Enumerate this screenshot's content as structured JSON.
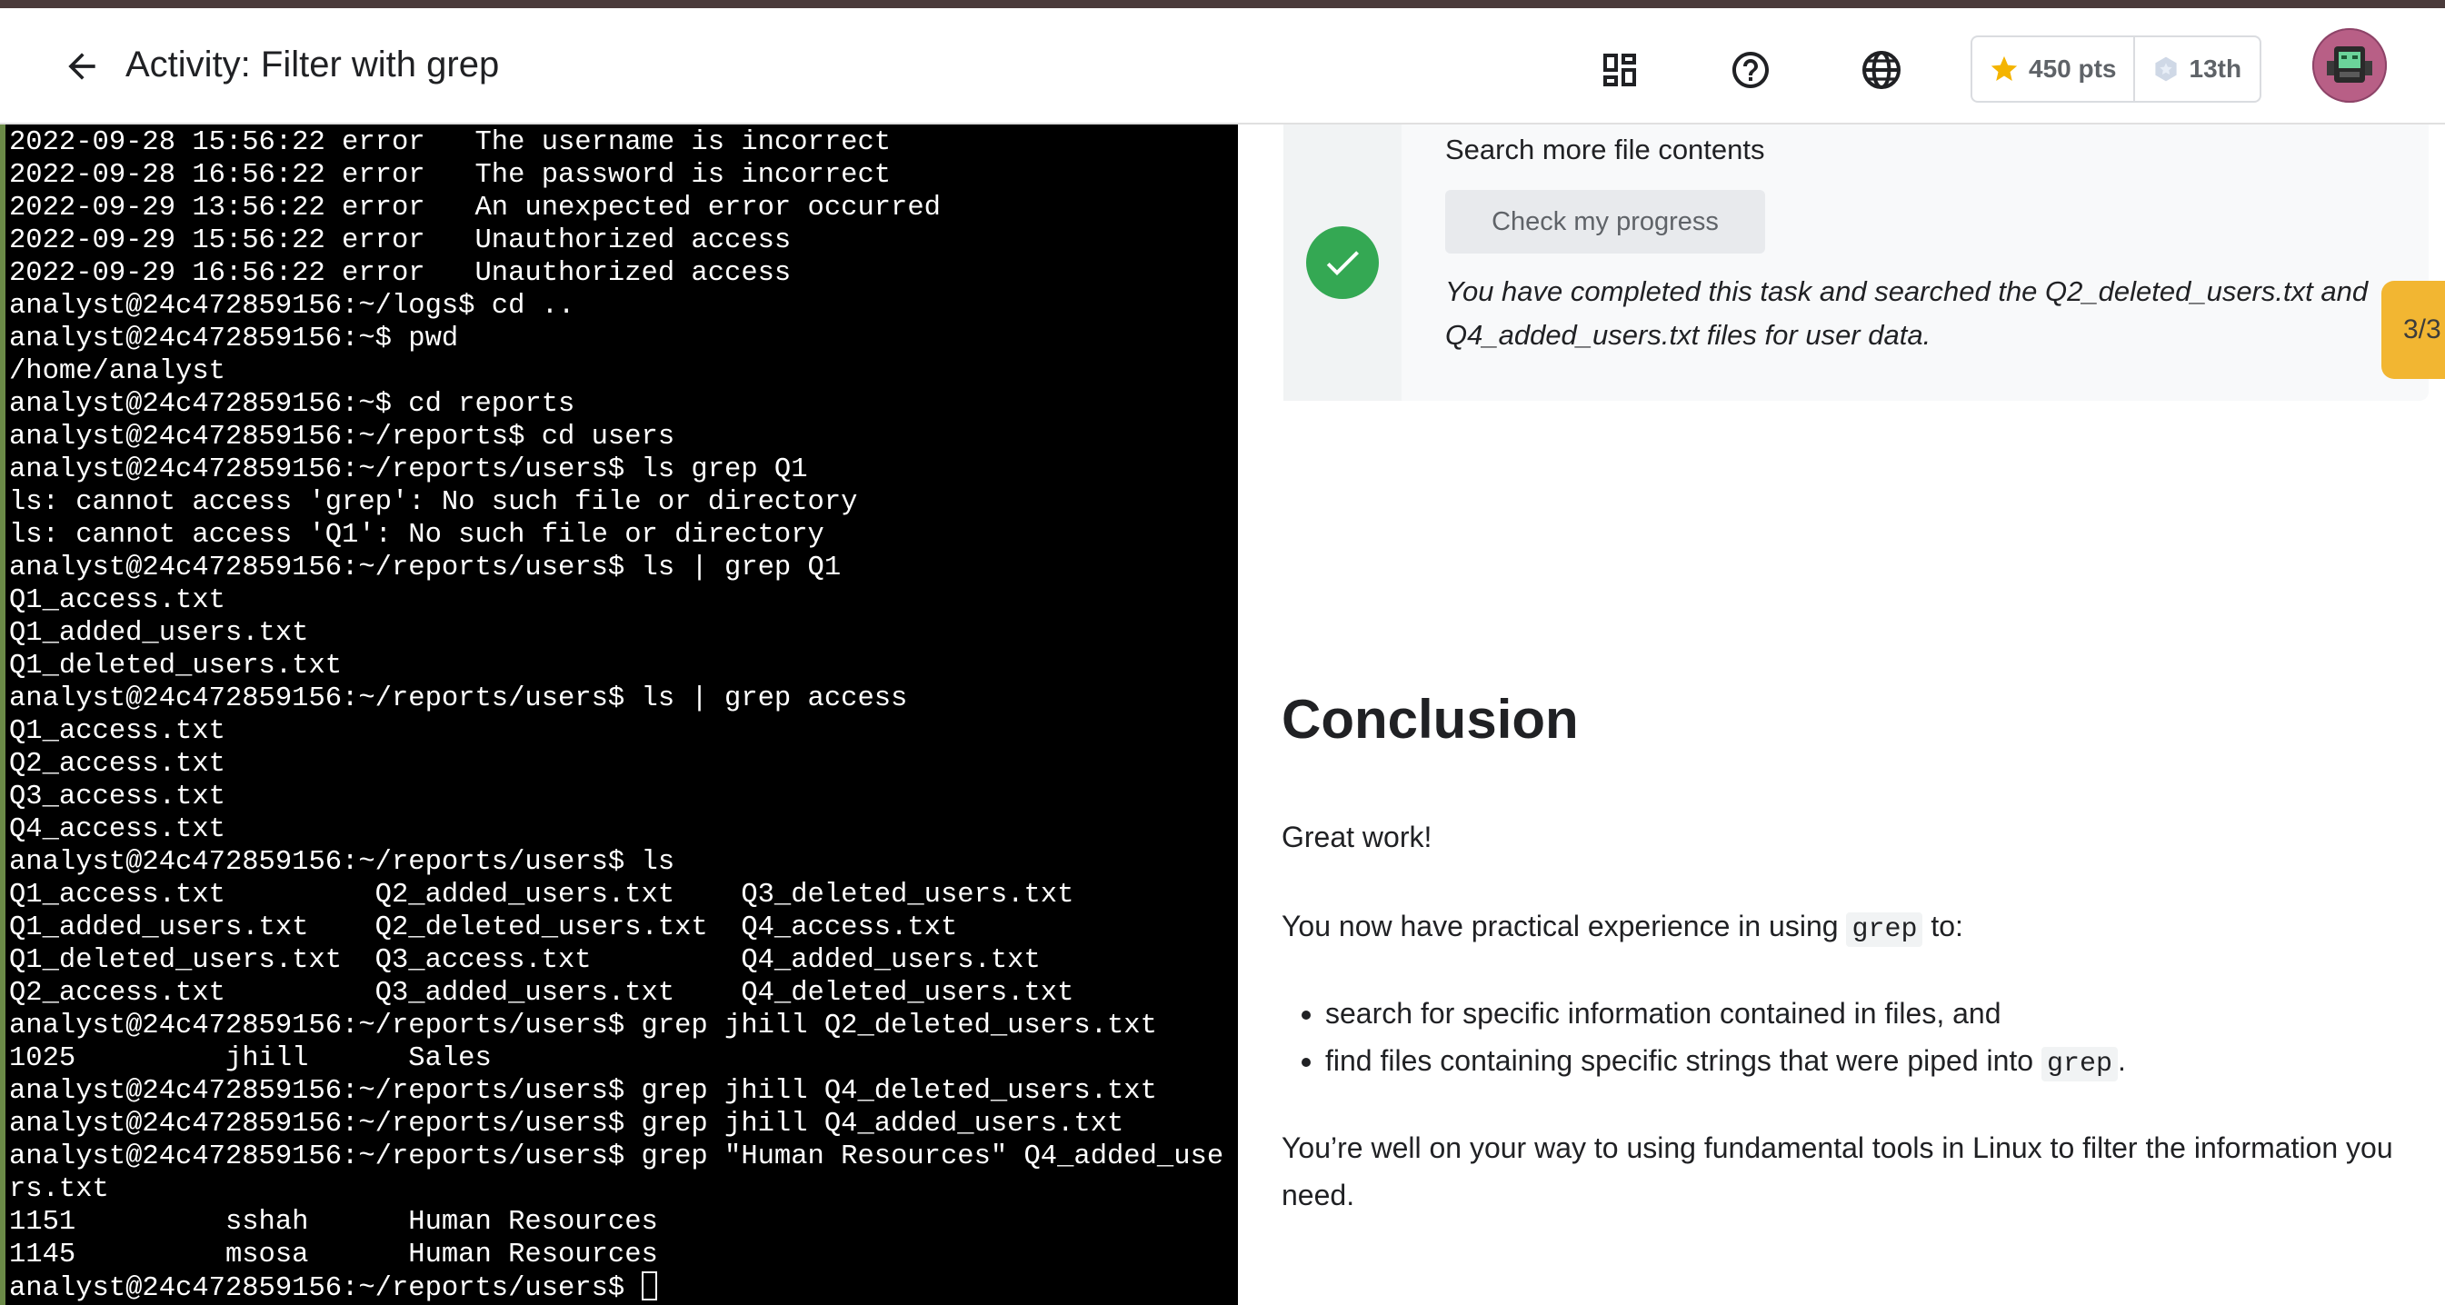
{
  "header": {
    "title": "Activity: Filter with grep",
    "points": "450 pts",
    "rank": "13th"
  },
  "icons": {
    "back": "arrow-left-icon",
    "dashboard": "dashboard-icon",
    "help": "help-circle-icon",
    "language": "globe-icon",
    "star": "star-icon",
    "rank": "hexagon-badge-icon",
    "avatar": "avatar"
  },
  "colors": {
    "terminal_bg": "#000000",
    "terminal_text": "#ffffff",
    "success": "#34a853",
    "star": "#f4b400",
    "page_tab": "#f2b632"
  },
  "terminal": {
    "lines": [
      "2022-09-28 15:56:22 error   The username is incorrect",
      "2022-09-28 16:56:22 error   The password is incorrect",
      "2022-09-29 13:56:22 error   An unexpected error occurred",
      "2022-09-29 15:56:22 error   Unauthorized access",
      "2022-09-29 16:56:22 error   Unauthorized access",
      "analyst@24c472859156:~/logs$ cd ..",
      "analyst@24c472859156:~$ pwd",
      "/home/analyst",
      "analyst@24c472859156:~$ cd reports",
      "analyst@24c472859156:~/reports$ cd users",
      "analyst@24c472859156:~/reports/users$ ls grep Q1",
      "ls: cannot access 'grep': No such file or directory",
      "ls: cannot access 'Q1': No such file or directory",
      "analyst@24c472859156:~/reports/users$ ls | grep Q1",
      "Q1_access.txt",
      "Q1_added_users.txt",
      "Q1_deleted_users.txt",
      "analyst@24c472859156:~/reports/users$ ls | grep access",
      "Q1_access.txt",
      "Q2_access.txt",
      "Q3_access.txt",
      "Q4_access.txt",
      "analyst@24c472859156:~/reports/users$ ls",
      "Q1_access.txt         Q2_added_users.txt    Q3_deleted_users.txt",
      "Q1_added_users.txt    Q2_deleted_users.txt  Q4_access.txt",
      "Q1_deleted_users.txt  Q3_access.txt         Q4_added_users.txt",
      "Q2_access.txt         Q3_added_users.txt    Q4_deleted_users.txt",
      "analyst@24c472859156:~/reports/users$ grep jhill Q2_deleted_users.txt",
      "1025         jhill      Sales",
      "analyst@24c472859156:~/reports/users$ grep jhill Q4_deleted_users.txt",
      "analyst@24c472859156:~/reports/users$ grep jhill Q4_added_users.txt",
      "analyst@24c472859156:~/reports/users$ grep \"Human Resources\" Q4_added_use",
      "rs.txt",
      "1151         sshah      Human Resources",
      "1145         msosa      Human Resources"
    ],
    "prompt": "analyst@24c472859156:~/reports/users$ "
  },
  "task": {
    "name": "Search more file contents",
    "check_button": "Check my progress",
    "completed_message": "You have completed this task and searched the Q2_deleted_users.txt and Q4_added_users.txt files for user data.",
    "page_indicator": "3/3"
  },
  "conclusion": {
    "title": "Conclusion",
    "great_work": "Great work!",
    "intro_prefix": "You now have practical experience in using ",
    "intro_code": "grep",
    "intro_suffix": " to:",
    "bullet1": "search for specific information contained in files, and",
    "bullet2_prefix": "find files containing specific strings that were piped into ",
    "bullet2_code": "grep",
    "bullet2_suffix": ".",
    "final": "You’re well on your way to using fundamental tools in Linux to filter the information you need."
  }
}
